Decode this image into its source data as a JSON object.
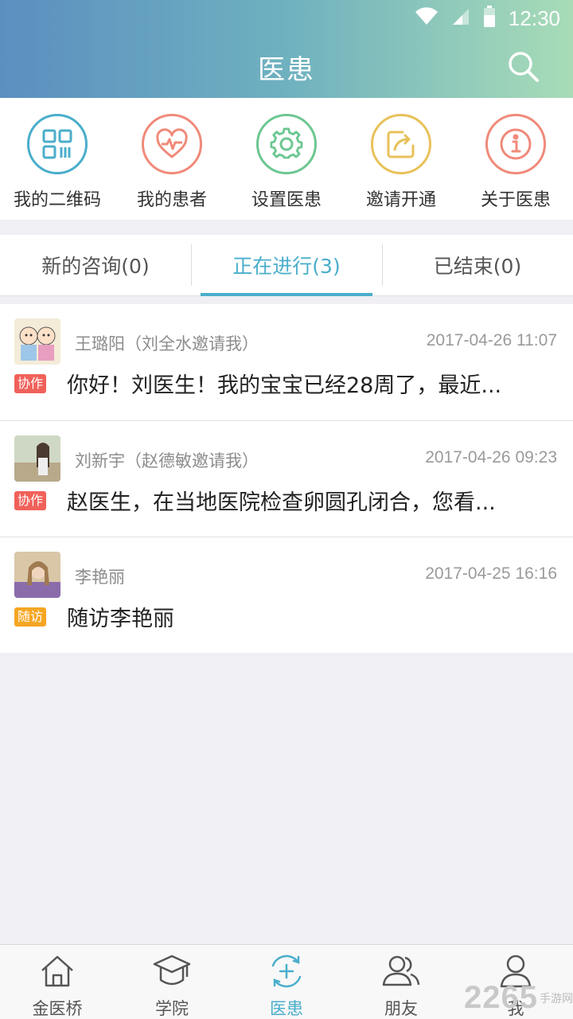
{
  "status_bar": {
    "time": "12:30"
  },
  "header": {
    "title": "医患"
  },
  "quick_actions": [
    {
      "label": "我的二维码",
      "color": "#4aaecb",
      "icon": "qrcode-icon"
    },
    {
      "label": "我的患者",
      "color": "#f08a7a",
      "icon": "heart-pulse-icon"
    },
    {
      "label": "设置医患",
      "color": "#6cc791",
      "icon": "gear-icon"
    },
    {
      "label": "邀请开通",
      "color": "#e8c15a",
      "icon": "share-icon"
    },
    {
      "label": "关于医患",
      "color": "#f08a7a",
      "icon": "info-icon"
    }
  ],
  "tabs": [
    {
      "label": "新的咨询(0)",
      "active": false
    },
    {
      "label": "正在进行(3)",
      "active": true
    },
    {
      "label": "已结束(0)",
      "active": false
    }
  ],
  "consults": [
    {
      "name": "王璐阳（刘全水邀请我）",
      "time": "2017-04-26 11:07",
      "tag": "协作",
      "tag_color": "#f0615a",
      "message": "你好！刘医生！我的宝宝已经28周了，最近..."
    },
    {
      "name": "刘新宇（赵德敏邀请我）",
      "time": "2017-04-26 09:23",
      "tag": "协作",
      "tag_color": "#f0615a",
      "message": "赵医生，在当地医院检查卵圆孔闭合，您看..."
    },
    {
      "name": "李艳丽",
      "time": "2017-04-25 16:16",
      "tag": "随访",
      "tag_color": "#f5a623",
      "message": "随访李艳丽"
    }
  ],
  "bottom_nav": [
    {
      "label": "金医桥",
      "icon": "home-icon",
      "active": false
    },
    {
      "label": "学院",
      "icon": "graduation-cap-icon",
      "active": false
    },
    {
      "label": "医患",
      "icon": "doctor-patient-icon",
      "active": true
    },
    {
      "label": "朋友",
      "icon": "friends-icon",
      "active": false
    },
    {
      "label": "我",
      "icon": "person-icon",
      "active": false
    }
  ],
  "watermark": {
    "number": "2265",
    "suffix": "手游网"
  },
  "colors": {
    "accent": "#4aaecb"
  }
}
